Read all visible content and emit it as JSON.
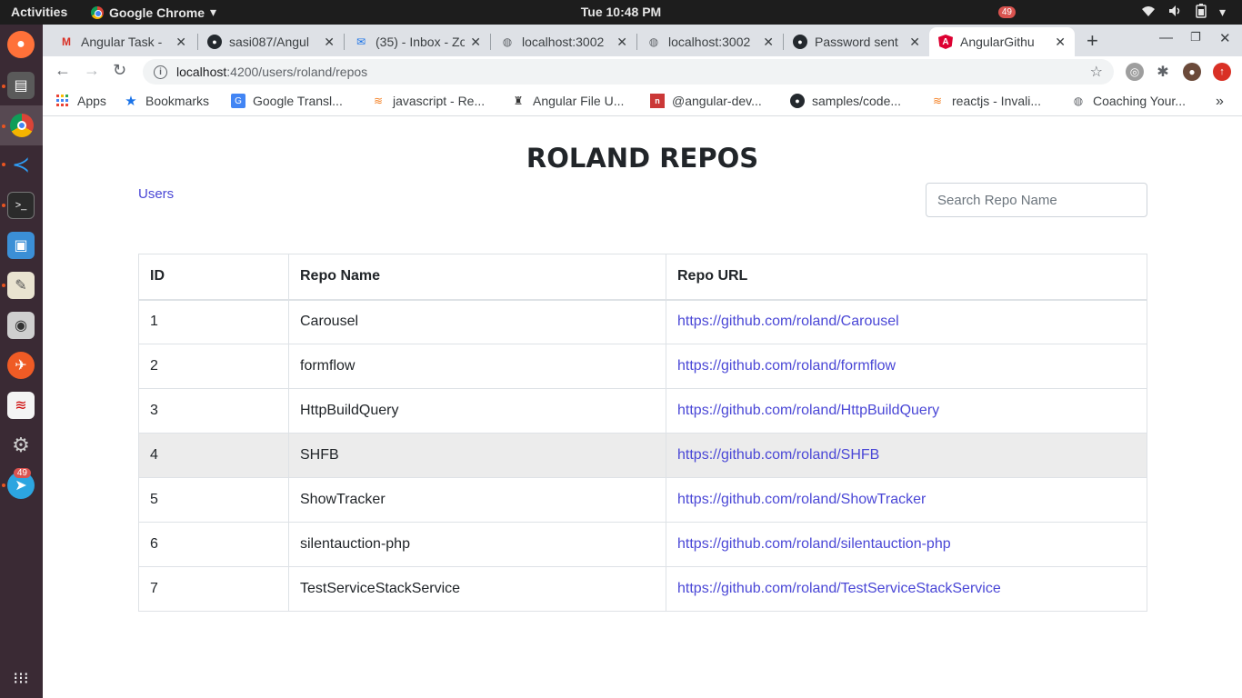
{
  "topbar": {
    "activities": "Activities",
    "app_name": "Google Chrome",
    "clock": "Tue 10:48 PM",
    "notification_count": "49"
  },
  "dock": {
    "telegram_badge": "49",
    "items": [
      "firefox-icon",
      "files-icon",
      "chrome-icon",
      "vscode-icon",
      "terminal-icon",
      "image-viewer-icon",
      "text-editor-icon",
      "screenshot-icon",
      "postman-icon",
      "libreoffice-icon",
      "settings-icon",
      "telegram-icon",
      "app-grid-icon"
    ]
  },
  "tabs": [
    {
      "title": "Angular Task -",
      "icon": "gmail-icon"
    },
    {
      "title": "sasi087/Angul",
      "icon": "github-icon"
    },
    {
      "title": "(35) - Inbox - Zo",
      "icon": "mail-icon"
    },
    {
      "title": "localhost:3002",
      "icon": "globe-icon"
    },
    {
      "title": "localhost:3002",
      "icon": "globe-icon"
    },
    {
      "title": "Password sent",
      "icon": "github-icon"
    },
    {
      "title": "AngularGithu",
      "icon": "angular-icon",
      "active": true
    }
  ],
  "address_bar": {
    "host": "localhost",
    "path": ":4200/users/roland/repos"
  },
  "bookmarks": [
    {
      "label": "Apps",
      "icon": "apps-grid-icon"
    },
    {
      "label": "Bookmarks",
      "icon": "star-icon"
    },
    {
      "label": "Google Transl...",
      "icon": "translate-icon"
    },
    {
      "label": "javascript - Re...",
      "icon": "stackoverflow-icon"
    },
    {
      "label": "Angular File U...",
      "icon": "bookmark-favicon-icon"
    },
    {
      "label": "@angular-dev...",
      "icon": "npm-icon"
    },
    {
      "label": "samples/code...",
      "icon": "github-icon"
    },
    {
      "label": "reactjs - Invali...",
      "icon": "stackoverflow-icon"
    },
    {
      "label": "Coaching Your...",
      "icon": "globe-icon"
    }
  ],
  "page": {
    "title": "ROLAND REPOS",
    "users_link": "Users",
    "search_placeholder": "Search Repo Name",
    "columns": [
      "ID",
      "Repo Name",
      "Repo URL"
    ],
    "rows": [
      {
        "id": "1",
        "name": "Carousel",
        "url": "https://github.com/roland/Carousel"
      },
      {
        "id": "2",
        "name": "formflow",
        "url": "https://github.com/roland/formflow"
      },
      {
        "id": "3",
        "name": "HttpBuildQuery",
        "url": "https://github.com/roland/HttpBuildQuery"
      },
      {
        "id": "4",
        "name": "SHFB",
        "url": "https://github.com/roland/SHFB"
      },
      {
        "id": "5",
        "name": "ShowTracker",
        "url": "https://github.com/roland/ShowTracker"
      },
      {
        "id": "6",
        "name": "silentauction-php",
        "url": "https://github.com/roland/silentauction-php"
      },
      {
        "id": "7",
        "name": "TestServiceStackService",
        "url": "https://github.com/roland/TestServiceStackService"
      }
    ],
    "highlighted_row": 3
  },
  "colors": {
    "link": "#4a47d6",
    "dock_bg": "#3a2a34",
    "topbar_bg": "#1d1d1d",
    "tabstrip_bg": "#dee1e6",
    "row_hover": "#ececec"
  }
}
